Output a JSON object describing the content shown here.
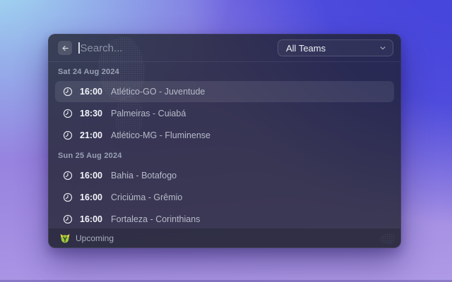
{
  "window": {
    "search": {
      "placeholder": "Search...",
      "back_icon": "arrow-left"
    },
    "filter": {
      "selected": "All Teams",
      "chevron_icon": "chevron-down"
    },
    "sections": [
      {
        "date": "Sat 24 Aug 2024",
        "matches": [
          {
            "time": "16:00",
            "fixture": "Atlético-GO - Juventude",
            "selected": true
          },
          {
            "time": "18:30",
            "fixture": "Palmeiras - Cuiabá",
            "selected": false
          },
          {
            "time": "21:00",
            "fixture": "Atlético-MG - Fluminense",
            "selected": false
          }
        ]
      },
      {
        "date": "Sun 25 Aug 2024",
        "matches": [
          {
            "time": "16:00",
            "fixture": "Bahia - Botafogo",
            "selected": false
          },
          {
            "time": "16:00",
            "fixture": "Criciúma - Grêmio",
            "selected": false
          },
          {
            "time": "16:00",
            "fixture": "Fortaleza - Corinthians",
            "selected": false
          }
        ]
      }
    ],
    "footer": {
      "status": "Upcoming",
      "league_icon": "brasileirao-crest"
    },
    "row_icon": "clock-outline"
  },
  "colors": {
    "bg_top_left_cyan": "#a7e6f3",
    "bg_top_right_blue": "#4343dc",
    "bg_bottom_purple": "#af9ae6",
    "window_tint": "rgba(30,32,44,0.78)",
    "row_highlight": "rgba(255,255,255,0.09)",
    "league_green": "#9dc93d",
    "league_yellow": "#f3d23c",
    "time_text": "#f3f5fa",
    "fixture_text": "#b6bbc9",
    "section_date_text": "#99a0b3"
  }
}
